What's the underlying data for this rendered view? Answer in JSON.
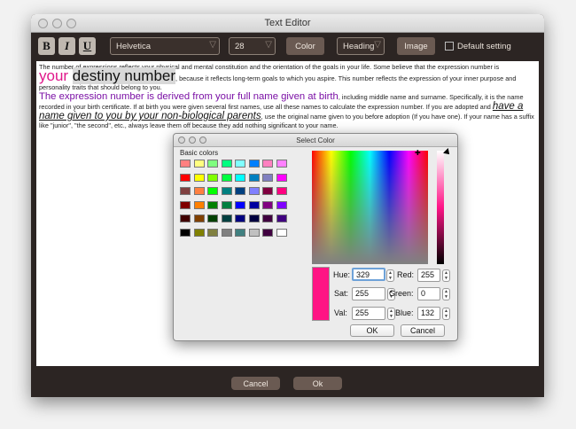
{
  "window": {
    "title": "Text Editor"
  },
  "toolbar": {
    "bold": "B",
    "italic": "I",
    "underline": "U",
    "font": "Helvetica",
    "size": "28",
    "color_label": "Color",
    "style": "Heading",
    "image_label": "Image",
    "default_label": "Default setting"
  },
  "content": {
    "p1": "The number of expressions reflects your physical and mental constitution and the orientation of the goals in your life. Some believe that the expression number is",
    "big_a": "your ",
    "big_b": "destiny number",
    "p1b": ", because it reflects long-term goals to which you aspire. This number reflects the expression of your inner purpose and personality traits that should belong to you.",
    "purple": "The expression number is derived from your full name given at birth",
    "p2": ", including middle name and surname. Specifically, it is the name recorded in your birth certificate. If at birth you were given several first names, use all these names to calculate the expression number. If you are adopted and",
    "underlined": "have a name given to you by your non-biological parents",
    "p3": ", use the original name given to you before adoption (If you have one). If your name has a suffix like \"junior\", \"the second\", etc., always leave them off because they add nothing significant to your name."
  },
  "footer": {
    "cancel": "Cancel",
    "ok": "Ok"
  },
  "dialog": {
    "title": "Select Color",
    "basic_colors_label": "Basic colors",
    "hue_label": "Hue:",
    "hue": "329",
    "sat_label": "Sat:",
    "sat": "255",
    "val_label": "Val:",
    "val": "255",
    "red_label": "Red:",
    "red": "255",
    "green_label": "Green:",
    "green": "0",
    "blue_label": "Blue:",
    "blue": "132",
    "ok": "OK",
    "cancel": "Cancel",
    "current_color": "#ff1484",
    "swatches": [
      "#ff8080",
      "#ffff80",
      "#80ff80",
      "#00ff80",
      "#80ffff",
      "#0080ff",
      "#ff80c0",
      "#ff80ff",
      "#ff0000",
      "#ffff00",
      "#80ff00",
      "#00ff40",
      "#00ffff",
      "#0080c0",
      "#8080c0",
      "#ff00ff",
      "#804040",
      "#ff8040",
      "#00ff00",
      "#008080",
      "#004080",
      "#8080ff",
      "#800040",
      "#ff0080",
      "#800000",
      "#ff8000",
      "#008000",
      "#008040",
      "#0000ff",
      "#0000a0",
      "#800080",
      "#8000ff",
      "#400000",
      "#804000",
      "#004000",
      "#004040",
      "#000080",
      "#000040",
      "#400040",
      "#400080",
      "#000000",
      "#808000",
      "#808040",
      "#808080",
      "#408080",
      "#c0c0c0",
      "#400040",
      "#ffffff"
    ]
  }
}
